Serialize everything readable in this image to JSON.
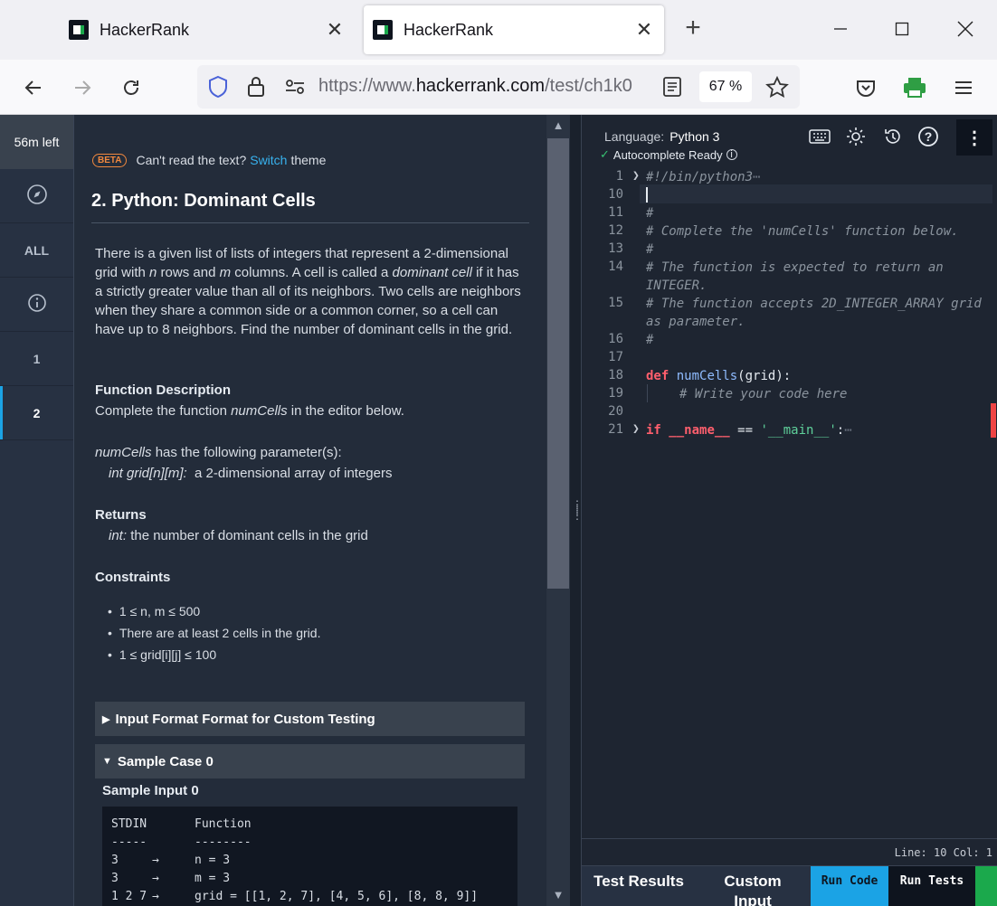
{
  "browser": {
    "tabs": [
      {
        "title": "HackerRank",
        "active": false
      },
      {
        "title": "HackerRank",
        "active": true
      }
    ],
    "url_prefix": "https://www.",
    "url_domain": "hackerrank.com",
    "url_path": "/test/ch1k0",
    "zoom": "67 %"
  },
  "sidebar": {
    "timer": "56m left",
    "all_label": "ALL",
    "questions": [
      "1",
      "2"
    ],
    "active_question": "2"
  },
  "problem": {
    "beta_badge": "BETA",
    "theme_prompt": "Can't read the text?",
    "theme_link": "Switch",
    "theme_suffix": "theme",
    "title": "2. Python: Dominant Cells",
    "description": [
      "There is a given list of lists of integers that represent a",
      "2-dimensional grid with",
      "n",
      "rows and",
      "m",
      "columns. A cell is called a",
      "dominant cell",
      "if it has a strictly greater value than all of its neighbors. Two cells are neighbors when they share a common side or a common corner, so a cell can have up to 8 neighbors. Find the number of dominant cells in the grid."
    ],
    "function_description_heading": "Function Description",
    "function_description": [
      "Complete the function",
      "numCells",
      "in the editor below."
    ],
    "params_intro": [
      "numCells",
      "has the following parameter(s):"
    ],
    "param": [
      "int grid[n][m]:",
      "a 2-dimensional array of integers"
    ],
    "returns_heading": "Returns",
    "returns": [
      "int:",
      "the number of dominant cells in the grid"
    ],
    "constraints_heading": "Constraints",
    "constraints": [
      "1 ≤ n, m ≤ 500",
      "There are at least 2 cells in the grid.",
      "1 ≤ grid[i][j] ≤ 100"
    ],
    "accordion_input_format": "Input Format Format for Custom Testing",
    "accordion_sample": "Sample Case 0",
    "sample_input_title": "Sample Input 0",
    "sample_table": [
      [
        "STDIN",
        "",
        "Function"
      ],
      [
        "-----",
        "",
        "--------"
      ],
      [
        "3",
        "→",
        "n = 3"
      ],
      [
        "3",
        "→",
        "m = 3"
      ],
      [
        "1 2 7",
        "→",
        "grid = [[1, 2, 7], [4, 5, 6], [8, 8, 9]]"
      ]
    ]
  },
  "editor": {
    "language_label": "Language:",
    "language": "Python 3",
    "autocomplete": "Autocomplete Ready",
    "line_numbers": [
      "1",
      "10",
      "11",
      "12",
      "13",
      "14",
      "15",
      "16",
      "17",
      "18",
      "19",
      "20",
      "21"
    ],
    "shebang": "#!/bin/python3",
    "comment_hash": "#",
    "comment_complete": "# Complete the 'numCells' function below.",
    "comment_returns": "# The function is expected to return an INTEGER.",
    "comment_accepts": "# The function accepts 2D_INTEGER_ARRAY grid as parameter.",
    "def_kw": "def",
    "def_name": "numCells",
    "def_args": "(grid):",
    "body_comment": "# Write your code here",
    "if_kw": "if",
    "if_name": "__name__",
    "if_op": "==",
    "if_str": "'__main__'",
    "if_colon": ":",
    "ellipsis": "⋯",
    "status": "Line: 10 Col: 1",
    "buttons": {
      "test_results": "Test Results",
      "custom_input": "Custom Input",
      "run_code": "Run Code",
      "run_tests": "Run Tests"
    }
  }
}
